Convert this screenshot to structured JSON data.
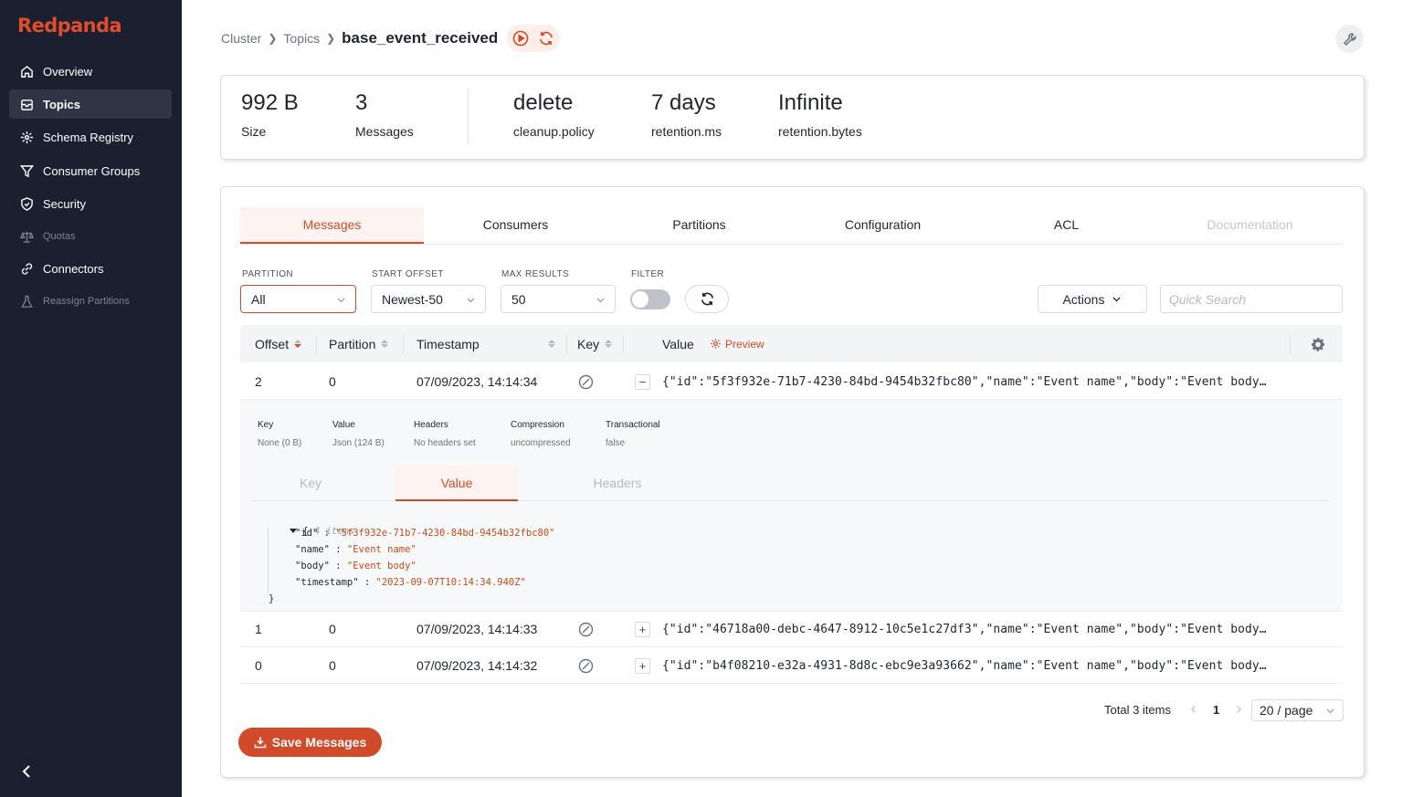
{
  "brand": {
    "name": "Redpanda"
  },
  "sidebar": {
    "items": [
      {
        "label": "Overview",
        "icon": "home-icon"
      },
      {
        "label": "Topics",
        "icon": "inbox-icon",
        "active": true
      },
      {
        "label": "Schema Registry",
        "icon": "schema-icon"
      },
      {
        "label": "Consumer Groups",
        "icon": "filter-icon"
      },
      {
        "label": "Security",
        "icon": "shield-icon"
      },
      {
        "label": "Quotas",
        "icon": "scale-icon",
        "disabled": true
      },
      {
        "label": "Connectors",
        "icon": "link-icon"
      },
      {
        "label": "Reassign Partitions",
        "icon": "flask-icon",
        "disabled": true
      }
    ]
  },
  "breadcrumb": {
    "cluster": "Cluster",
    "topics": "Topics",
    "current": "base_event_received"
  },
  "stats": [
    {
      "value": "992 B",
      "label": "Size"
    },
    {
      "value": "3",
      "label": "Messages"
    },
    {
      "value": "delete",
      "label": "cleanup.policy"
    },
    {
      "value": "7 days",
      "label": "retention.ms"
    },
    {
      "value": "Infinite",
      "label": "retention.bytes"
    }
  ],
  "tabs": [
    "Messages",
    "Consumers",
    "Partitions",
    "Configuration",
    "ACL",
    "Documentation"
  ],
  "filters": {
    "partition_label": "PARTITION",
    "partition_value": "All",
    "start_offset_label": "START OFFSET",
    "start_offset_value": "Newest-50",
    "max_results_label": "MAX RESULTS",
    "max_results_value": "50",
    "filter_label": "FILTER",
    "filter_enabled": false,
    "actions_label": "Actions",
    "search_placeholder": "Quick Search"
  },
  "table": {
    "headers": {
      "offset": "Offset",
      "partition": "Partition",
      "timestamp": "Timestamp",
      "key": "Key",
      "value": "Value",
      "preview": "Preview"
    },
    "rows": [
      {
        "offset": "2",
        "partition": "0",
        "timestamp": "07/09/2023, 14:14:34",
        "value": "{\"id\":\"5f3f932e-71b7-4230-84bd-9454b32fbc80\",\"name\":\"Event name\",\"body\":\"Event body…",
        "expanded": true,
        "toggle": "−"
      },
      {
        "offset": "1",
        "partition": "0",
        "timestamp": "07/09/2023, 14:14:33",
        "value": "{\"id\":\"46718a00-debc-4647-8912-10c5e1c27df3\",\"name\":\"Event name\",\"body\":\"Event body…",
        "toggle": "+"
      },
      {
        "offset": "0",
        "partition": "0",
        "timestamp": "07/09/2023, 14:14:32",
        "value": "{\"id\":\"b4f08210-e32a-4931-8d8c-ebc9e3a93662\",\"name\":\"Event name\",\"body\":\"Event body…",
        "toggle": "+"
      }
    ]
  },
  "detail": {
    "meta": [
      {
        "key": "Key",
        "value": "None (0 B)"
      },
      {
        "key": "Value",
        "value": "Json (124 B)"
      },
      {
        "key": "Headers",
        "value": "No headers set"
      },
      {
        "key": "Compression",
        "value": "uncompressed"
      },
      {
        "key": "Transactional",
        "value": "false"
      }
    ],
    "tabs": [
      "Key",
      "Value",
      "Headers"
    ],
    "json": {
      "open": "{",
      "count": "4 items",
      "fields": [
        {
          "key": "\"id\"",
          "value": "\"5f3f932e-71b7-4230-84bd-9454b32fbc80\""
        },
        {
          "key": "\"name\"",
          "value": "\"Event name\""
        },
        {
          "key": "\"body\"",
          "value": "\"Event body\""
        },
        {
          "key": "\"timestamp\"",
          "value": "\"2023-09-07T10:14:34.940Z\""
        }
      ],
      "close": "}"
    }
  },
  "pagination": {
    "total": "Total 3 items",
    "current": "1",
    "page_size": "20 / page"
  },
  "save_button": "Save Messages",
  "colors": {
    "accent": "#d14b2a",
    "brand": "#e14d2a",
    "sidebar": "#1a2030"
  }
}
